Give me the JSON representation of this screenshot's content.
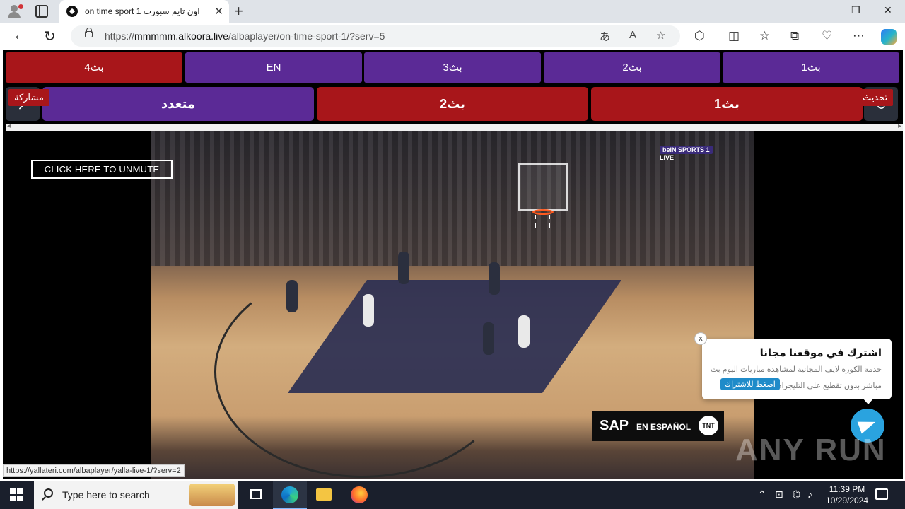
{
  "browser": {
    "tab_title": "اون تايم سبورت 1 on time sport",
    "tab_close": "✕",
    "new_tab": "+",
    "window_controls": {
      "minimize": "—",
      "maximize": "❐",
      "close": "✕"
    },
    "url_prefix": "https://",
    "url_host": "mmmmm.alkoora.live",
    "url_path": "/albaplayer/on-time-sport-1/?serv=5",
    "nav_icons": {
      "back": "←",
      "reload": "↻"
    }
  },
  "page": {
    "server_buttons_row1": [
      {
        "label": "بث4",
        "color": "red"
      },
      {
        "label": "EN",
        "color": "purple"
      },
      {
        "label": "بث3",
        "color": "purple"
      },
      {
        "label": "بث2",
        "color": "purple"
      },
      {
        "label": "بث1",
        "color": "purple"
      }
    ],
    "server_buttons_row2": [
      {
        "label": "متعدد",
        "color": "purple"
      },
      {
        "label": "بث2",
        "color": "red"
      },
      {
        "label": "بث1",
        "color": "red"
      }
    ],
    "share_label": "مشاركة",
    "refresh_label": "تحديث",
    "unmute_label": "CLICK HERE TO UNMUTE",
    "video_overlays": {
      "channel_badge": "beIN SPORTS 1",
      "live_label": "LIVE",
      "sap_text": "SAP",
      "sap_sub": "EN ESPAÑOL",
      "tnt_label": "TNT"
    },
    "popup": {
      "close": "x",
      "title": "اشترك في موقعنا مجانا",
      "desc_line1": "خدمة الكورة لايف المجانية لمشاهدة مباريات اليوم بث",
      "desc_line2": "مباشر بدون تقطيع على التليجرام",
      "button": "اضغط للاشتراك"
    },
    "watermark": "ANY RUN",
    "status_url": "https://yallateri.com/albaplayer/yalla-live-1/?serv=2"
  },
  "taskbar": {
    "search_placeholder": "Type here to search",
    "time": "11:39 PM",
    "date": "10/29/2024"
  },
  "colors": {
    "purple": "#5b2a96",
    "red": "#a8161a",
    "popup_button": "#1f8bc9",
    "telegram": "#2aa3df"
  }
}
